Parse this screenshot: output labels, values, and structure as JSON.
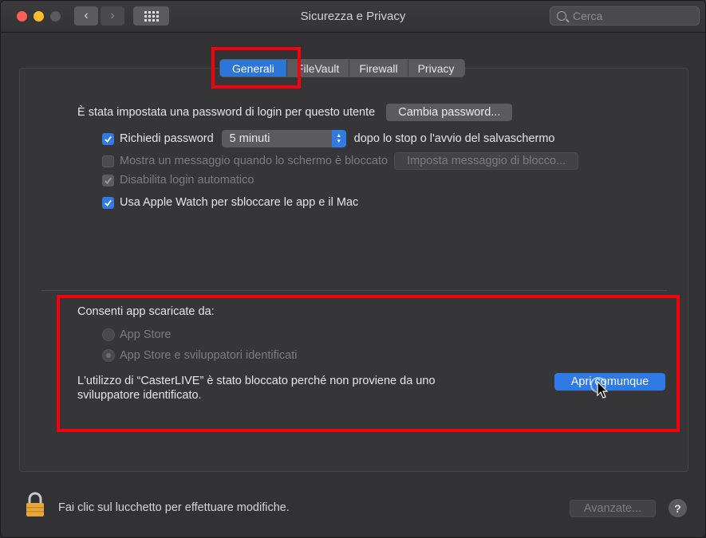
{
  "window": {
    "title": "Sicurezza e Privacy",
    "search_placeholder": "Cerca"
  },
  "tabs": [
    {
      "label": "Generali",
      "active": true
    },
    {
      "label": "FileVault",
      "active": false
    },
    {
      "label": "Firewall",
      "active": false
    },
    {
      "label": "Privacy",
      "active": false
    }
  ],
  "general": {
    "password_set_text": "È stata impostata una password di login per questo utente",
    "change_password_button": "Cambia password...",
    "require_password": {
      "label": "Richiedi password",
      "checked": true
    },
    "require_password_delay": "5 minuti",
    "require_password_suffix": "dopo lo stop o l'avvio del salvaschermo",
    "show_message": {
      "label": "Mostra un messaggio quando lo schermo è bloccato",
      "checked": false,
      "enabled": false
    },
    "set_message_button": "Imposta messaggio di blocco...",
    "disable_auto_login": {
      "label": "Disabilita login automatico",
      "checked": true,
      "enabled": false
    },
    "apple_watch": {
      "label": "Usa Apple Watch per sbloccare le app e il Mac",
      "checked": true
    }
  },
  "allow_apps": {
    "heading": "Consenti app scaricate da:",
    "options": [
      {
        "label": "App Store",
        "selected": false
      },
      {
        "label": "App Store e sviluppatori identificati",
        "selected": true
      }
    ],
    "blocked_message_line1": "L'utilizzo di “CasterLIVE” è stato bloccato perché non proviene da uno",
    "blocked_message_line2": "sviluppatore identificato.",
    "open_anyway_button": "Apri comunque"
  },
  "footer": {
    "lock_text": "Fai clic sul lucchetto per effettuare modifiche.",
    "advanced_button": "Avanzate...",
    "help_label": "?"
  },
  "colors": {
    "accent": "#2f7ae5",
    "highlight": "#f5000b"
  }
}
